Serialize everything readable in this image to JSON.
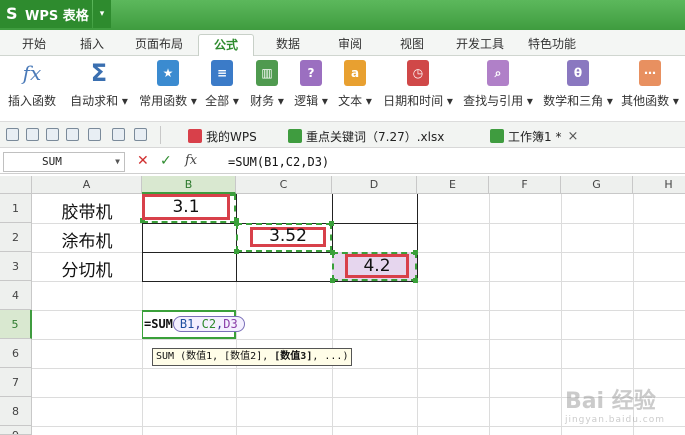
{
  "app": {
    "title": "WPS 表格",
    "menu_arrow": "▾"
  },
  "ribbon_tabs": [
    {
      "label": "开始"
    },
    {
      "label": "插入"
    },
    {
      "label": "页面布局"
    },
    {
      "label": "公式"
    },
    {
      "label": "数据"
    },
    {
      "label": "审阅"
    },
    {
      "label": "视图"
    },
    {
      "label": "开发工具"
    },
    {
      "label": "特色功能"
    }
  ],
  "active_tab": "公式",
  "ribbon_buttons": [
    {
      "label": "插入函数",
      "icon": "fx-icon",
      "glyph": "fx"
    },
    {
      "label": "自动求和 ▾",
      "icon": "sigma-icon",
      "glyph": "Σ"
    },
    {
      "label": "常用函数 ▾",
      "icon": "star-book-icon",
      "glyph": "★"
    },
    {
      "label": "全部 ▾",
      "icon": "all-functions-book-icon",
      "glyph": "≡"
    },
    {
      "label": "财务 ▾",
      "icon": "finance-book-icon",
      "glyph": "▥"
    },
    {
      "label": "逻辑 ▾",
      "icon": "logic-book-icon",
      "glyph": "?"
    },
    {
      "label": "文本 ▾",
      "icon": "text-book-icon",
      "glyph": "a"
    },
    {
      "label": "日期和时间 ▾",
      "icon": "datetime-book-icon",
      "glyph": "◷"
    },
    {
      "label": "查找与引用 ▾",
      "icon": "lookup-book-icon",
      "glyph": "⌕"
    },
    {
      "label": "数学和三角 ▾",
      "icon": "math-book-icon",
      "glyph": "θ"
    },
    {
      "label": "其他函数 ▾",
      "icon": "other-book-icon",
      "glyph": "⋯"
    }
  ],
  "doc_tabs": [
    {
      "label": "我的WPS"
    },
    {
      "label": "重点关键词（7.27）.xlsx"
    },
    {
      "label": "工作簿1 *"
    }
  ],
  "formula_bar": {
    "name_box": "SUM",
    "fx_label": "fx",
    "content": "=SUM(B1,C2,D3)"
  },
  "columns": [
    "A",
    "B",
    "C",
    "D",
    "E",
    "F",
    "G",
    "H"
  ],
  "rows": [
    "1",
    "2",
    "3",
    "4",
    "5",
    "6",
    "7",
    "8",
    "9"
  ],
  "cells": {
    "A1": "胶带机",
    "A2": "涂布机",
    "A3": "分切机",
    "B1": "3.1",
    "C2": "3.52",
    "D3": "4.2"
  },
  "editing": {
    "prefix": "=SUM",
    "refs": [
      "B1",
      "C2",
      "D3"
    ],
    "tooltip_normal": "SUM (数值1, [数值2], ",
    "tooltip_bold": "[数值3]",
    "tooltip_end": ", ...)"
  },
  "watermark": {
    "logo": "Bai 经验",
    "url": "jingyan.baidu.com"
  },
  "colors": {
    "accent_green": "#3f9c3f",
    "highlight_red": "#d8404a"
  }
}
